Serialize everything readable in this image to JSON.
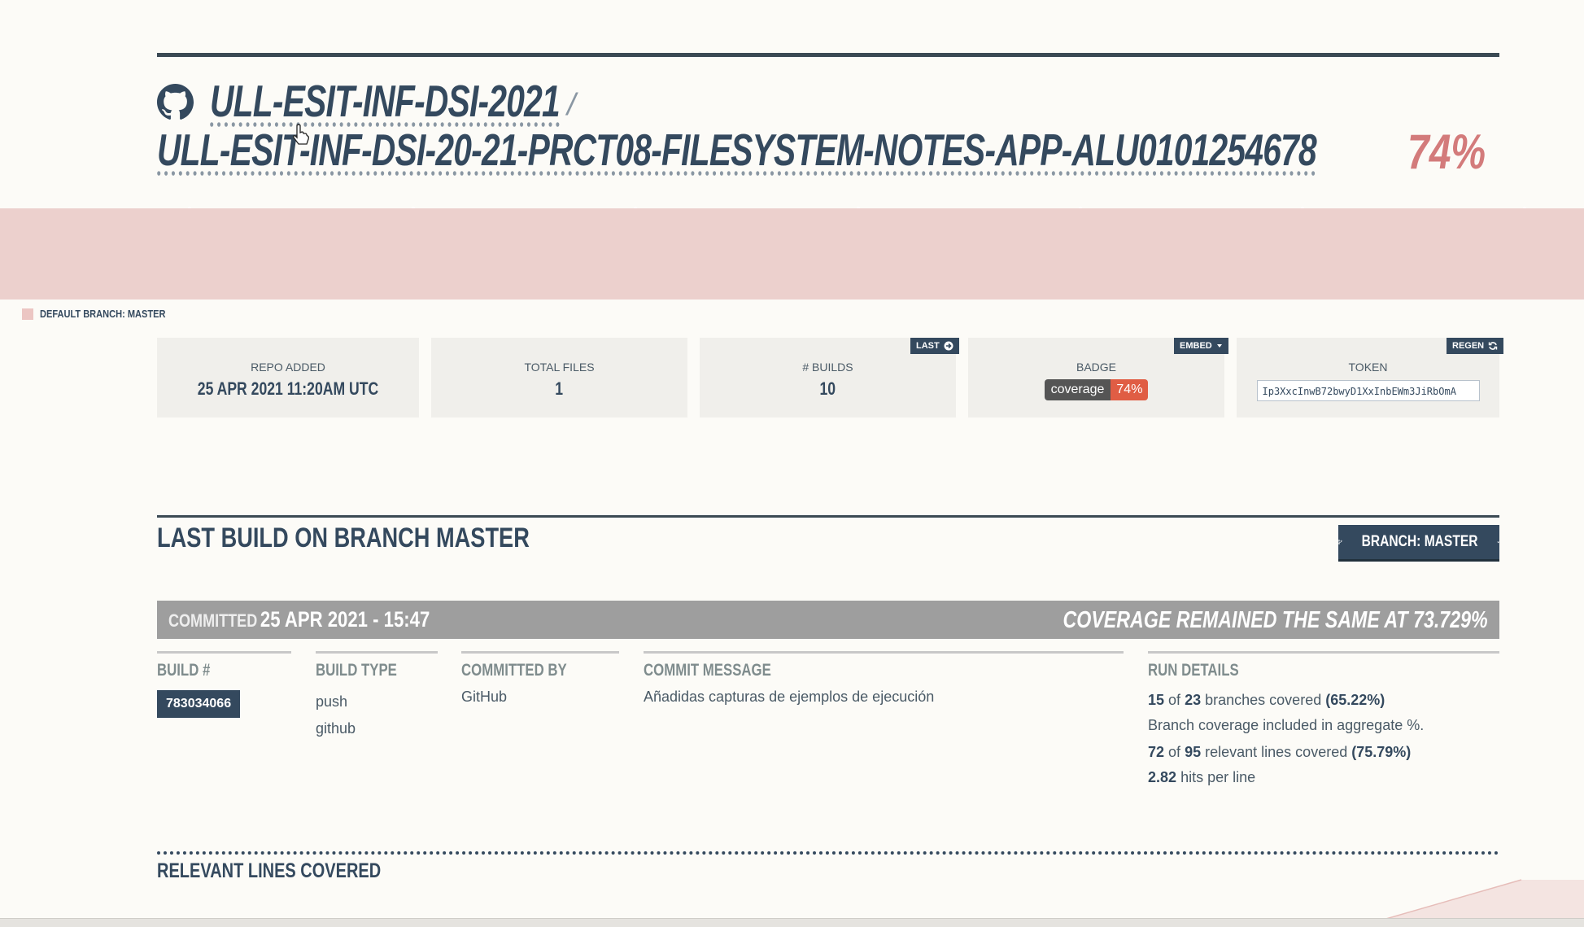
{
  "header": {
    "org": "ULL-ESIT-INF-DSI-2021",
    "separator": "/",
    "repo": "ULL-ESIT-INF-DSI-20-21-PRCT08-FILESYSTEM-NOTES-APP-ALU0101254678",
    "coverage_percent": "74%",
    "icon": "github-icon"
  },
  "legend": {
    "label": "DEFAULT BRANCH: MASTER",
    "color": "#ecc6c3"
  },
  "stats": {
    "repo_added": {
      "label": "REPO ADDED",
      "value": "25 APR 2021 11:20AM UTC"
    },
    "total_files": {
      "label": "TOTAL FILES",
      "value": "1"
    },
    "builds": {
      "label": "# BUILDS",
      "value": "10",
      "action": "LAST"
    },
    "badge": {
      "label": "BADGE",
      "action": "EMBED",
      "left": "coverage",
      "right": "74%"
    },
    "token": {
      "label": "TOKEN",
      "action": "REGEN",
      "value": "Ip3XxcInwB72bwyD1XxInbEWm3JiRbOmA"
    }
  },
  "last_build": {
    "title": "LAST BUILD ON BRANCH MASTER",
    "branch_button": "BRANCH: MASTER",
    "committed_label": "COMMITTED",
    "committed_value": "25 APR 2021 - 15:47",
    "coverage_summary": "COVERAGE REMAINED THE SAME AT 73.729%",
    "columns": {
      "build": {
        "head": "BUILD #",
        "value": "783034066"
      },
      "type": {
        "head": "BUILD TYPE",
        "values": [
          "push",
          "github"
        ]
      },
      "by": {
        "head": "COMMITTED BY",
        "value": "GitHub"
      },
      "message": {
        "head": "COMMIT MESSAGE",
        "value": "Añadidas capturas de ejemplos de ejecución"
      },
      "run": {
        "head": "RUN DETAILS",
        "branches_covered": "15",
        "branches_of": "of",
        "branches_total": "23",
        "branches_text": "branches covered",
        "branches_pct": "(65.22%)",
        "aggregate_note": "Branch coverage included in aggregate %.",
        "lines_covered": "72",
        "lines_of": "of",
        "lines_total": "95",
        "lines_text": "relevant lines covered",
        "lines_pct": "(75.79%)",
        "hits": "2.82",
        "hits_text": "hits per line"
      }
    }
  },
  "relevant_lines": {
    "title": "RELEVANT LINES COVERED"
  },
  "colors": {
    "accent": "#34495e",
    "coverage": "#d37b7b",
    "band": "#ecd0cd",
    "badge_red": "#e05d44"
  }
}
